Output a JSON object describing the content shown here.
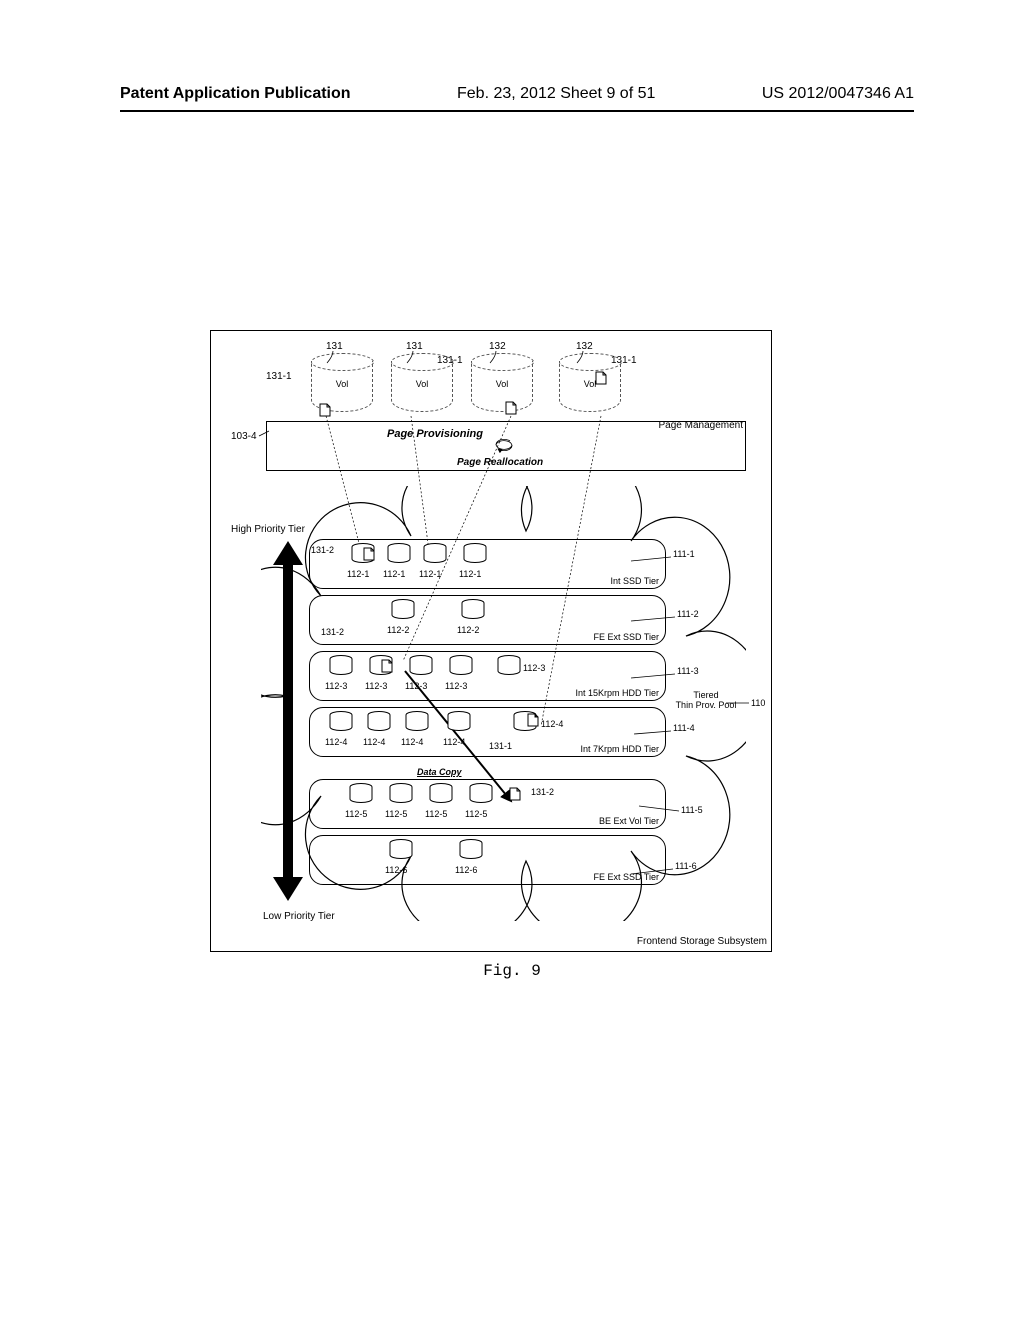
{
  "header": {
    "left": "Patent Application Publication",
    "center": "Feb. 23, 2012  Sheet 9 of 51",
    "right": "US 2012/0047346 A1"
  },
  "caption": "Fig. 9",
  "volumes": {
    "vol_label": "Vol",
    "ref131": "131",
    "ref132": "132",
    "ref131_1": "131-1"
  },
  "page_mgmt": {
    "provisioning": "Page Provisioning",
    "reallocation": "Page Reallocation",
    "management": "Page Management",
    "ref103_4": "103-4"
  },
  "priority": {
    "high": "High Priority Tier",
    "low": "Low Priority Tier"
  },
  "pool": {
    "label_line1": "Tiered",
    "label_line2": "Thin Prov. Pool",
    "ref110": "110",
    "ref131_2": "131-2",
    "ref131_1": "131-1",
    "data_copy": "Data Copy"
  },
  "tiers": [
    {
      "label": "Int SSD Tier",
      "ref": "111-1",
      "cyl_ref": "112-1"
    },
    {
      "label": "FE Ext SSD Tier",
      "ref": "111-2",
      "cyl_ref": "112-2"
    },
    {
      "label": "Int 15Krpm HDD Tier",
      "ref": "111-3",
      "cyl_ref": "112-3"
    },
    {
      "label": "Int 7Krpm HDD Tier",
      "ref": "111-4",
      "cyl_ref": "112-4"
    },
    {
      "label": "BE Ext Vol Tier",
      "ref": "111-5",
      "cyl_ref": "112-5"
    },
    {
      "label": "FE Ext SSD Tier",
      "ref": "111-6",
      "cyl_ref": "112-6"
    }
  ],
  "footer": "Frontend Storage Subsystem"
}
